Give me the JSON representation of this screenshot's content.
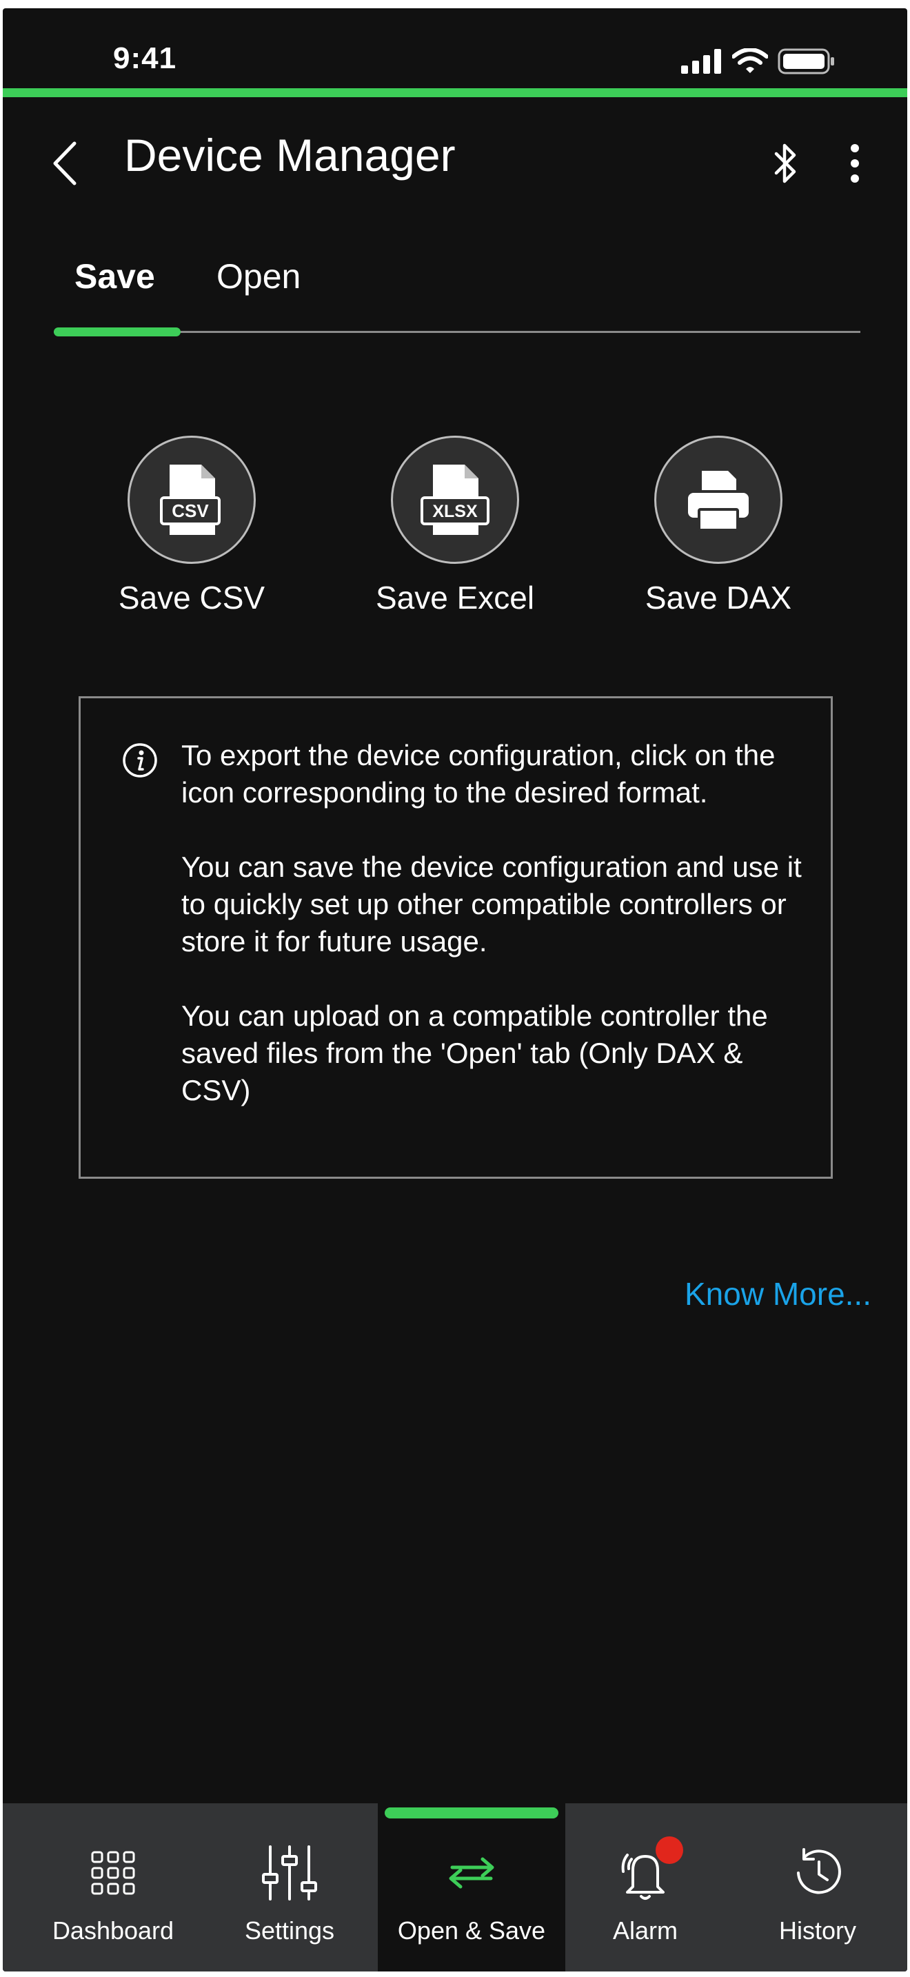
{
  "status_bar": {
    "time": "9:41",
    "icons": [
      "signal-icon",
      "wifi-icon",
      "battery-icon"
    ]
  },
  "app_bar": {
    "title": "Device Manager",
    "back_icon": "chevron-left-icon",
    "bluetooth_icon": "bluetooth-icon",
    "more_icon": "more-vertical-icon"
  },
  "tabs": [
    {
      "label": "Save",
      "active": true
    },
    {
      "label": "Open",
      "active": false
    }
  ],
  "save_actions": [
    {
      "label": "Save CSV",
      "file_tag": "CSV",
      "icon": "csv-file-icon"
    },
    {
      "label": "Save Excel",
      "file_tag": "XLSX",
      "icon": "xlsx-file-icon"
    },
    {
      "label": "Save DAX",
      "icon": "printer-icon"
    }
  ],
  "info": {
    "icon": "info-icon",
    "paragraphs": [
      "To export the device configuration, click on the icon corresponding to the desired format.",
      "You can save the device configuration and use it to quickly set up other compatible controllers or store it for future usage.",
      "You can upload on a compatible controller the saved files from the 'Open' tab (Only DAX & CSV)"
    ]
  },
  "know_more": "Know More...",
  "bottom_nav": [
    {
      "label": "Dashboard",
      "icon": "grid-icon",
      "active": false
    },
    {
      "label": "Settings",
      "icon": "sliders-icon",
      "active": false
    },
    {
      "label": "Open & Save",
      "icon": "transfer-icon",
      "active": true
    },
    {
      "label": "Alarm",
      "icon": "alarm-bell-icon",
      "active": false,
      "badge": true
    },
    {
      "label": "History",
      "icon": "history-icon",
      "active": false
    }
  ],
  "colors": {
    "accent": "#3dcd58",
    "background": "#111111",
    "nav_background": "#333436",
    "link": "#1aa3e8",
    "badge": "#e1261c"
  }
}
